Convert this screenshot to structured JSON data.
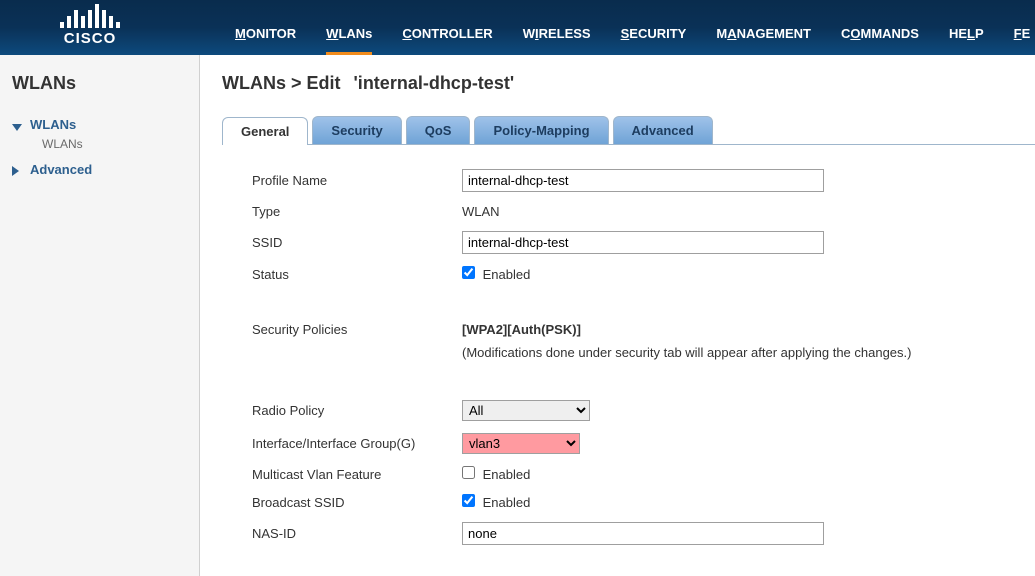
{
  "topnav": {
    "monitor": "MONITOR",
    "wlans": "WLANs",
    "controller": "CONTROLLER",
    "wireless": "WIRELESS",
    "security": "SECURITY",
    "management": "MANAGEMENT",
    "commands": "COMMANDS",
    "help": "HELP",
    "feedback": "FEEDBACK"
  },
  "logo_text": "CISCO",
  "sidebar": {
    "title": "WLANs",
    "wlans_node": "WLANs",
    "wlans_child": "WLANs",
    "advanced_node": "Advanced"
  },
  "breadcrumb": {
    "section": "WLANs > Edit",
    "item": "'internal-dhcp-test'"
  },
  "tabs": {
    "general": "General",
    "security": "Security",
    "qos": "QoS",
    "policy": "Policy-Mapping",
    "advanced": "Advanced"
  },
  "labels": {
    "profile_name": "Profile Name",
    "type": "Type",
    "ssid": "SSID",
    "status": "Status",
    "security_policies": "Security Policies",
    "radio_policy": "Radio Policy",
    "interface_group": "Interface/Interface Group(G)",
    "multicast_vlan": "Multicast Vlan Feature",
    "broadcast_ssid": "Broadcast SSID",
    "nas_id": "NAS-ID",
    "enabled_text": "Enabled"
  },
  "values": {
    "profile_name": "internal-dhcp-test",
    "type": "WLAN",
    "ssid": "internal-dhcp-test",
    "status_checked": true,
    "security_policy": "[WPA2][Auth(PSK)]",
    "security_note": "(Modifications done under security tab will appear after applying the changes.)",
    "radio_policy": "All",
    "interface_group": "vlan3",
    "multicast_checked": false,
    "broadcast_checked": true,
    "nas_id": "none"
  }
}
